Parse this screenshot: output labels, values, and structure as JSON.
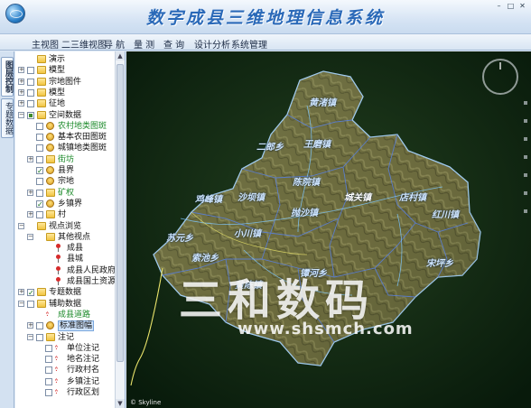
{
  "window": {
    "title": "数字成县三维地理信息系统",
    "controls": [
      "–",
      "□",
      "✕"
    ]
  },
  "menu": [
    "主视图",
    "二三维视图",
    "导 航",
    "量 测",
    "查 询",
    "设计分析",
    "系统管理"
  ],
  "side_tabs": [
    "图层控制",
    "专题数据"
  ],
  "tree": [
    {
      "label": "演示",
      "depth": 0,
      "expander": "",
      "check": "none",
      "icon": "folder-icon",
      "style": ""
    },
    {
      "label": "模型",
      "depth": 0,
      "expander": "+",
      "check": "unchecked",
      "icon": "folder-icon",
      "style": ""
    },
    {
      "label": "宗地图件",
      "depth": 0,
      "expander": "+",
      "check": "unchecked",
      "icon": "folder-icon",
      "style": ""
    },
    {
      "label": "模型",
      "depth": 0,
      "expander": "+",
      "check": "unchecked",
      "icon": "folder-icon",
      "style": ""
    },
    {
      "label": "征地",
      "depth": 0,
      "expander": "+",
      "check": "unchecked",
      "icon": "folder-icon",
      "style": ""
    },
    {
      "label": "空间数据",
      "depth": 0,
      "expander": "−",
      "check": "partial",
      "icon": "folder-icon",
      "style": ""
    },
    {
      "label": "农村地类图斑",
      "depth": 1,
      "expander": "",
      "check": "unchecked",
      "icon": "layer-icon",
      "style": "green"
    },
    {
      "label": "基本农田图斑",
      "depth": 1,
      "expander": "",
      "check": "unchecked",
      "icon": "layer-icon",
      "style": ""
    },
    {
      "label": "城镇地类图斑",
      "depth": 1,
      "expander": "",
      "check": "unchecked",
      "icon": "layer-icon",
      "style": ""
    },
    {
      "label": "街坊",
      "depth": 1,
      "expander": "+",
      "check": "unchecked",
      "icon": "folder-icon",
      "style": "green"
    },
    {
      "label": "县界",
      "depth": 1,
      "expander": "",
      "check": "checked",
      "icon": "layer-icon",
      "style": ""
    },
    {
      "label": "宗地",
      "depth": 1,
      "expander": "",
      "check": "unchecked",
      "icon": "layer-icon",
      "style": ""
    },
    {
      "label": "矿权",
      "depth": 1,
      "expander": "+",
      "check": "unchecked",
      "icon": "folder-icon",
      "style": "green"
    },
    {
      "label": "乡镇界",
      "depth": 1,
      "expander": "",
      "check": "checked",
      "icon": "layer-icon",
      "style": ""
    },
    {
      "label": "村",
      "depth": 1,
      "expander": "+",
      "check": "unchecked",
      "icon": "folder-icon",
      "style": ""
    },
    {
      "label": "视点浏览",
      "depth": 0,
      "expander": "−",
      "check": "none",
      "icon": "folder-icon",
      "style": ""
    },
    {
      "label": "其他视点",
      "depth": 1,
      "expander": "−",
      "check": "none",
      "icon": "folder-icon",
      "style": ""
    },
    {
      "label": "成县",
      "depth": 2,
      "expander": "",
      "check": "none",
      "icon": "pin-icon",
      "style": ""
    },
    {
      "label": "县城",
      "depth": 2,
      "expander": "",
      "check": "none",
      "icon": "pin-icon",
      "style": ""
    },
    {
      "label": "成县人民政府",
      "depth": 2,
      "expander": "",
      "check": "none",
      "icon": "pin-icon",
      "style": ""
    },
    {
      "label": "成县国土资源局",
      "depth": 2,
      "expander": "",
      "check": "none",
      "icon": "pin-icon",
      "style": ""
    },
    {
      "label": "专题数据",
      "depth": 0,
      "expander": "+",
      "check": "checked",
      "icon": "folder-icon",
      "style": ""
    },
    {
      "label": "辅助数据",
      "depth": 0,
      "expander": "−",
      "check": "unchecked",
      "icon": "folder-icon",
      "style": ""
    },
    {
      "label": "成县道路",
      "depth": 1,
      "expander": "",
      "check": "none",
      "icon": "road-icon",
      "style": "green"
    },
    {
      "label": "标准图幅",
      "depth": 1,
      "expander": "+",
      "check": "unchecked",
      "icon": "layer-icon",
      "style": "sel"
    },
    {
      "label": "注记",
      "depth": 1,
      "expander": "−",
      "check": "unchecked",
      "icon": "folder-icon",
      "style": ""
    },
    {
      "label": "单位注记",
      "depth": 2,
      "expander": "",
      "check": "unchecked",
      "icon": "point-icon",
      "style": ""
    },
    {
      "label": "地名注记",
      "depth": 2,
      "expander": "",
      "check": "unchecked",
      "icon": "point-icon",
      "style": ""
    },
    {
      "label": "行政村名",
      "depth": 2,
      "expander": "",
      "check": "unchecked",
      "icon": "point-icon",
      "style": ""
    },
    {
      "label": "乡镇注记",
      "depth": 2,
      "expander": "",
      "check": "unchecked",
      "icon": "point-icon",
      "style": ""
    },
    {
      "label": "行政区划",
      "depth": 2,
      "expander": "",
      "check": "unchecked",
      "icon": "point-icon",
      "style": ""
    }
  ],
  "map": {
    "labels": [
      "黄渚镇",
      "二郎乡",
      "王磨镇",
      "鸡峰镇",
      "沙坝镇",
      "陈院镇",
      "城关镇",
      "店村镇",
      "红川镇",
      "抛沙镇",
      "苏元乡",
      "小川镇",
      "索池乡",
      "黄陈镇",
      "宋坪乡",
      "镡河乡"
    ],
    "credit": "© Skyline",
    "colors": {
      "terrain": "#6b6a3e",
      "boundary": "#5a7fd8",
      "river": "#7fc8ff",
      "road": "#e9e36a"
    }
  },
  "watermark": {
    "text": "三和数码",
    "url": "www.shsmch.com"
  }
}
